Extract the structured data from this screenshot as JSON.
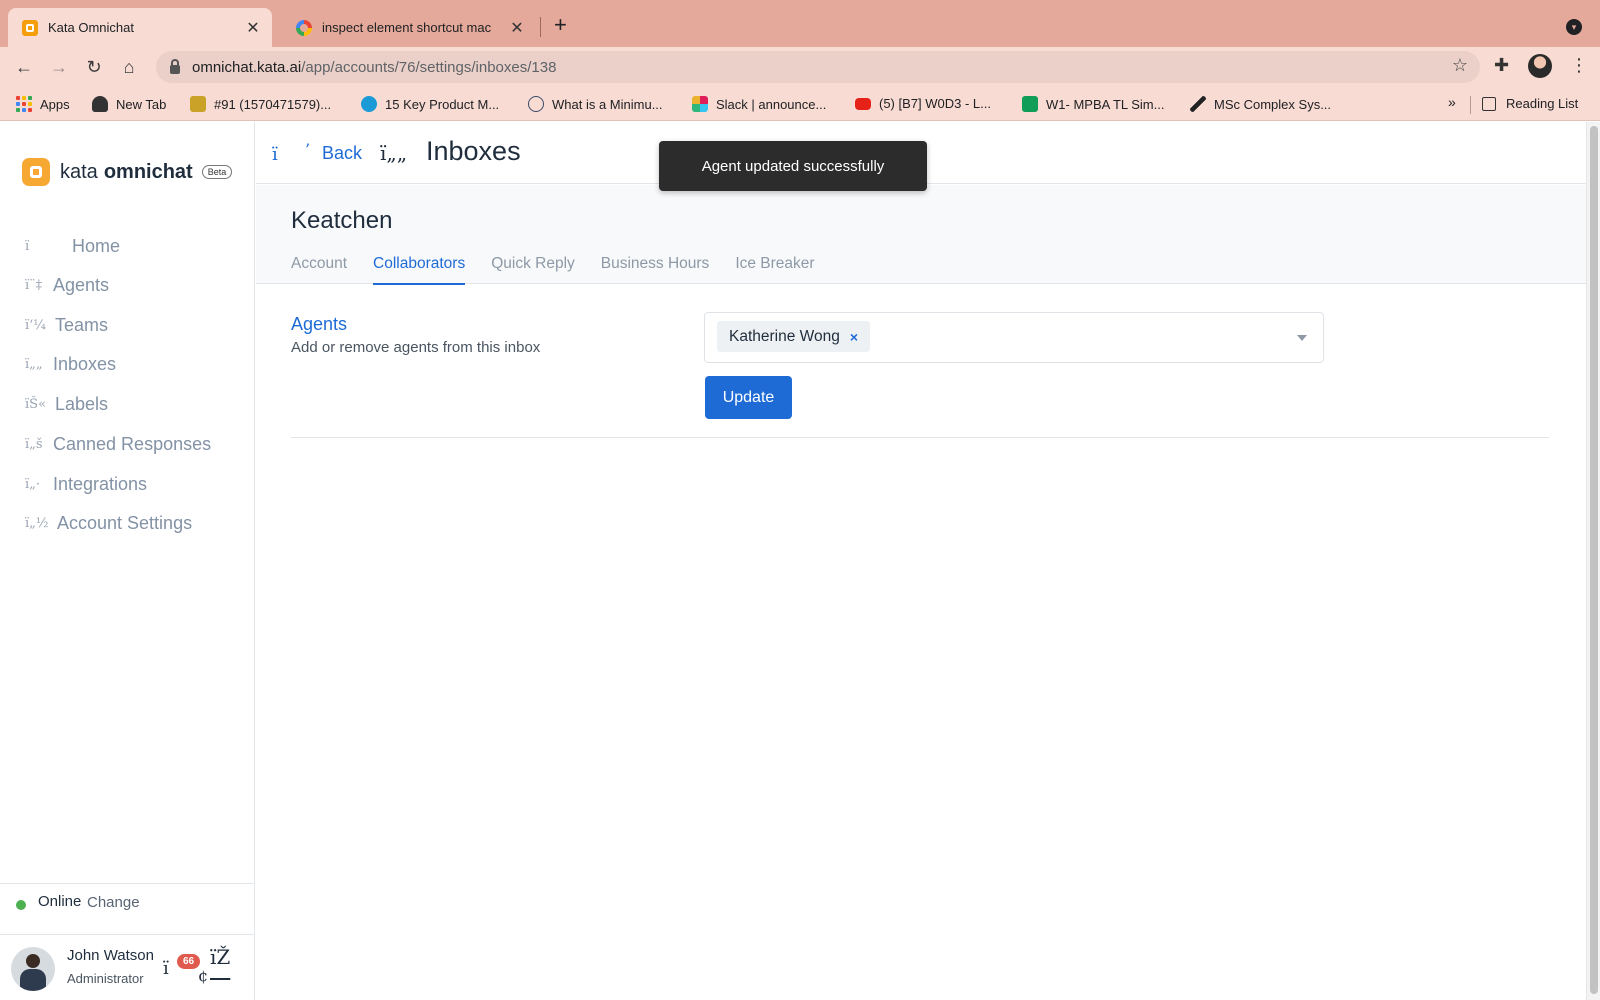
{
  "browser": {
    "tabs": [
      {
        "title": "Kata Omnichat",
        "close": "✕"
      },
      {
        "title": "inspect element shortcut mac",
        "close": "✕"
      }
    ],
    "new_tab": "+",
    "url_host": "omnichat.kata.ai",
    "url_path": "/app/accounts/76/settings/inboxes/138",
    "bookmarks": [
      {
        "label": "Apps",
        "icon": "apps-grid-icon"
      },
      {
        "label": "New Tab",
        "icon": "spy-icon"
      },
      {
        "label": "#91 (1570471579)...",
        "icon": "ras-icon"
      },
      {
        "label": "15 Key Product M...",
        "icon": "drop-icon"
      },
      {
        "label": "What is a Minimu...",
        "icon": "circle-a-icon"
      },
      {
        "label": "Slack | announce...",
        "icon": "slack-icon"
      },
      {
        "label": "(5) [B7] W0D3 - L...",
        "icon": "youtube-icon"
      },
      {
        "label": "W1- MPBA TL Sim...",
        "icon": "sheets-icon"
      },
      {
        "label": "MSc Complex Sys...",
        "icon": "swoosh-icon"
      }
    ],
    "more": "»",
    "reading_list": "Reading List"
  },
  "sidebar": {
    "brand_kata": "kata",
    "brand_omni": "omnichat",
    "beta": "Beta",
    "items": [
      {
        "glyph": "ï",
        "label": "Home"
      },
      {
        "glyph": "ï¨‡",
        "label": "Agents"
      },
      {
        "glyph": "ï‘¼",
        "label": "Teams"
      },
      {
        "glyph": "ï„„",
        "label": "Inboxes"
      },
      {
        "glyph": "ïŠ«",
        "label": "Labels"
      },
      {
        "glyph": "ï„š",
        "label": "Canned Responses"
      },
      {
        "glyph": "ï„·",
        "label": "Integrations"
      },
      {
        "glyph": "ï„½",
        "label": "Account Settings"
      }
    ],
    "status": "Online",
    "status_change": "Change",
    "user_name": "John Watson",
    "user_role": "Administrator",
    "user_glyph_1": "ï",
    "user_glyph_2": "¢",
    "user_glyph_3": "ïŽ",
    "notification_count": "66"
  },
  "header": {
    "back_glyph_1": "ï",
    "back_glyph_2": "’",
    "back_label": "Back",
    "title_glyph": "ï„„",
    "title": "Inboxes"
  },
  "toast": "Agent updated successfully",
  "inbox": {
    "name": "Keatchen",
    "tabs": [
      "Account",
      "Collaborators",
      "Quick Reply",
      "Business Hours",
      "Ice Breaker"
    ],
    "selected_tab": "Collaborators"
  },
  "agents_section": {
    "title": "Agents",
    "description": "Add or remove agents from this inbox",
    "selected_agents": [
      "Katherine Wong"
    ],
    "chip_remove": "×",
    "update_label": "Update"
  },
  "colors": {
    "tabbar": "#e4a99a",
    "accent": "#1f6bd6",
    "brand": "#f7a833",
    "online": "#4caf50",
    "badge": "#e05a4e"
  }
}
